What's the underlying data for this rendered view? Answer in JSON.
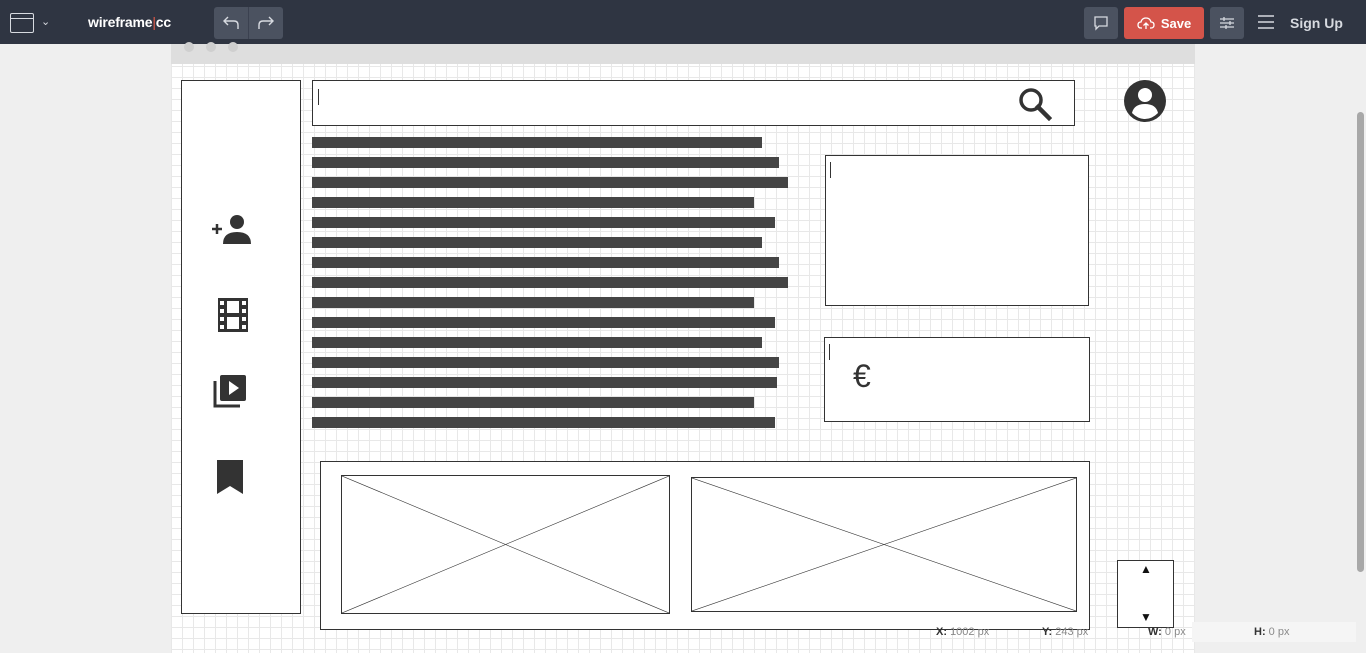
{
  "toolbar": {
    "logo_main": "wireframe",
    "logo_separator": "|",
    "logo_suffix": "cc",
    "save_label": "Save",
    "signup_label": "Sign Up",
    "icons": [
      "window-icon",
      "chevron-down-icon",
      "undo-icon",
      "redo-icon",
      "comment-icon",
      "cloud-upload-icon",
      "settings-sliders-icon",
      "hamburger-menu-icon"
    ],
    "colors": {
      "bar": "#2f3542",
      "save": "#d4544a",
      "button": "#4b5260"
    }
  },
  "canvas": {
    "sidebar_icons": [
      "add-user-icon",
      "film-icon",
      "video-library-icon",
      "bookmark-icon"
    ],
    "search_icon": "search-icon",
    "avatar_icon": "account-circle-icon",
    "currency_symbol": "€",
    "text_block_lines": 15,
    "image_placeholders": 2,
    "stepper": {
      "up": "▲",
      "down": "▼"
    }
  },
  "status": {
    "x_label": "X:",
    "x_value": "1002 px",
    "y_label": "Y:",
    "y_value": "243 px",
    "w_label": "W:",
    "w_value": "0 px",
    "h_label": "H:",
    "h_value": "0 px"
  }
}
